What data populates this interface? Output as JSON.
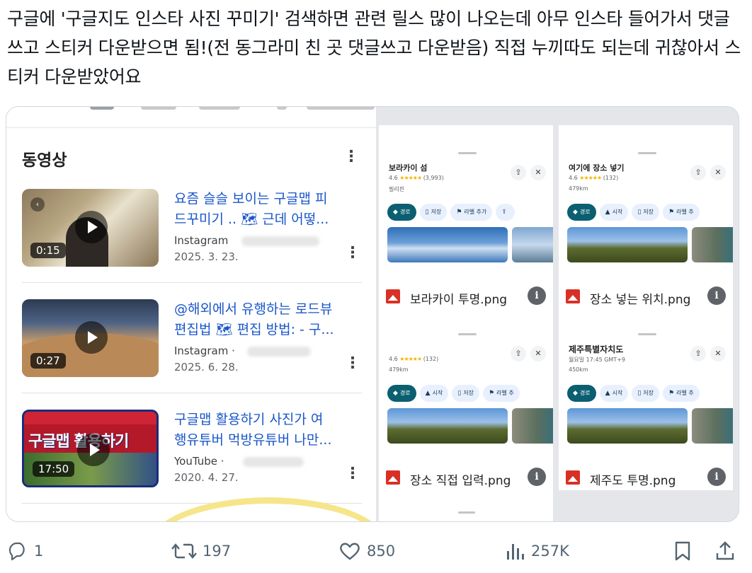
{
  "post": {
    "text": "구글에 '구글지도 인스타 사진 꾸미기' 검색하면 관련 릴스 많이 나오는데 아무 인스타 들어가서 댓글쓰고 스티커 다운받으면 됨!(전 동그라미 친 곳 댓글쓰고 다운받음) 직접 누끼따도 되는데 귀찮아서 스티커 다운받았어요"
  },
  "video_panel": {
    "section_title": "동영상",
    "videos": [
      {
        "title": "요즘 슬슬 보이는 구글맵 피\n드꾸미기 .. 🗺 근데 어떻...",
        "source": "Instagram",
        "date": "2025. 3. 23.",
        "duration": "0:15"
      },
      {
        "title": "@해외에서 유행하는 로드뷰\n편집법 🗺 편집 방법: - 구...",
        "source": "Instagram ·",
        "date": "2025. 6. 28.",
        "duration": "0:27"
      },
      {
        "title": "구글맵 활용하기 사진가 여\n행유튜버 먹방유튜버 나만...",
        "source": "YouTube ·",
        "date": "2020. 4. 27.",
        "duration": "17:50",
        "thumb_text": "구글맵 활용하기"
      }
    ]
  },
  "cards": [
    {
      "place": "보라카이 섬",
      "rating": "4.6",
      "stars": "★★★★★",
      "reviews": "(3,993)",
      "subinfo": "필리핀",
      "chips": [
        "경로",
        "저장",
        "라벨 추가",
        ""
      ],
      "file_name": "보라카이 투명.png"
    },
    {
      "place": "여기에 장소 넣기",
      "rating": "4.6",
      "stars": "★★★★★",
      "reviews": "(132)",
      "subinfo": "479km",
      "chips": [
        "경로",
        "시작",
        "저장",
        "라벨 추"
      ],
      "file_name": "장소 넣는 위치.png"
    },
    {
      "place": "",
      "rating": "4.6",
      "stars": "★★★★★",
      "reviews": "(132)",
      "subinfo": "479km",
      "chips": [
        "경로",
        "시작",
        "저장",
        "라벨 추"
      ],
      "file_name": "장소 직접 입력.png"
    },
    {
      "place": "제주특별자치도",
      "rating": "",
      "stars": "",
      "reviews": "",
      "subinfo": "월요일 17:45 GMT+9",
      "subinfo2": "450km",
      "chips": [
        "경로",
        "시작",
        "저장",
        "라벨 추"
      ],
      "file_name": "제주도 투명.png"
    }
  ],
  "actions": {
    "replies": "1",
    "reposts": "197",
    "likes": "850",
    "views": "257K"
  },
  "colors": {
    "link_blue": "#1a56c9",
    "route_chip": "#0b5f70",
    "file_red": "#d93025",
    "action_grey": "#536471"
  }
}
